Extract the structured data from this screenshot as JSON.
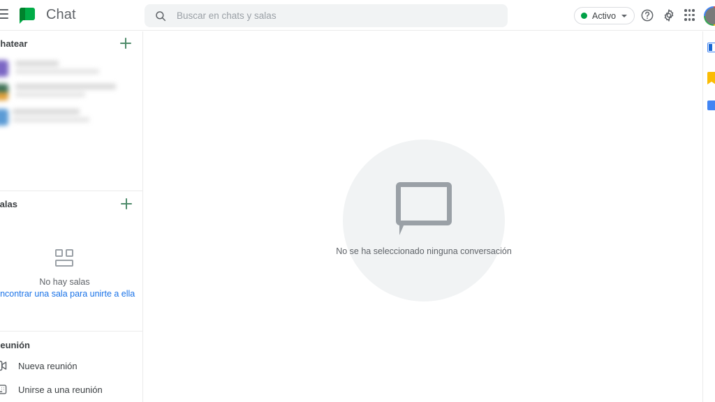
{
  "header": {
    "menu_icon": "hamburger-menu-icon",
    "logo_icon": "chat-logo-icon",
    "title": "Chat",
    "search": {
      "icon": "search-icon",
      "placeholder": "Buscar en chats y salas",
      "value": ""
    },
    "status": {
      "label": "Activo",
      "dot_color": "#00a147",
      "caret_icon": "chevron-down-icon"
    },
    "help_icon": "help-circle-icon",
    "settings_icon": "gear-icon",
    "apps_icon": "apps-grid-icon",
    "avatar_icon": "account-avatar"
  },
  "sidebar": {
    "chat_section": {
      "title": "Chatear",
      "add_icon": "plus-icon",
      "add_color": "#4e8b6a",
      "conversations": [
        {
          "avatar_color": "#7b66c4",
          "redacted": true
        },
        {
          "avatar_color": "#3f7257",
          "avatar_color_2": "#e2a23c",
          "redacted": true
        },
        {
          "avatar_color": "#5b9bd5",
          "redacted": true
        }
      ]
    },
    "rooms_section": {
      "title": "Salas",
      "add_icon": "plus-icon",
      "empty_icon": "rooms-icon",
      "empty_text": "No hay salas",
      "empty_link": "Encontrar una sala para unirte a ella",
      "link_color": "#1a73e8"
    },
    "meeting_section": {
      "title": "Reunión",
      "items": [
        {
          "icon": "video-camera-plus-icon",
          "label": "Nueva reunión"
        },
        {
          "icon": "keyboard-icon",
          "label": "Unirse a una reunión"
        }
      ]
    }
  },
  "main": {
    "empty_state": {
      "icon": "speech-bubble-icon",
      "circle_color": "#f1f3f4",
      "text": "No se ha seleccionado ninguna conversación"
    }
  },
  "side_panel": {
    "items": [
      {
        "icon": "google-calendar-icon",
        "color": "#4285f4"
      },
      {
        "icon": "google-keep-icon",
        "color": "#fbbc04"
      },
      {
        "icon": "google-tasks-icon",
        "color": "#4285f4"
      }
    ]
  }
}
